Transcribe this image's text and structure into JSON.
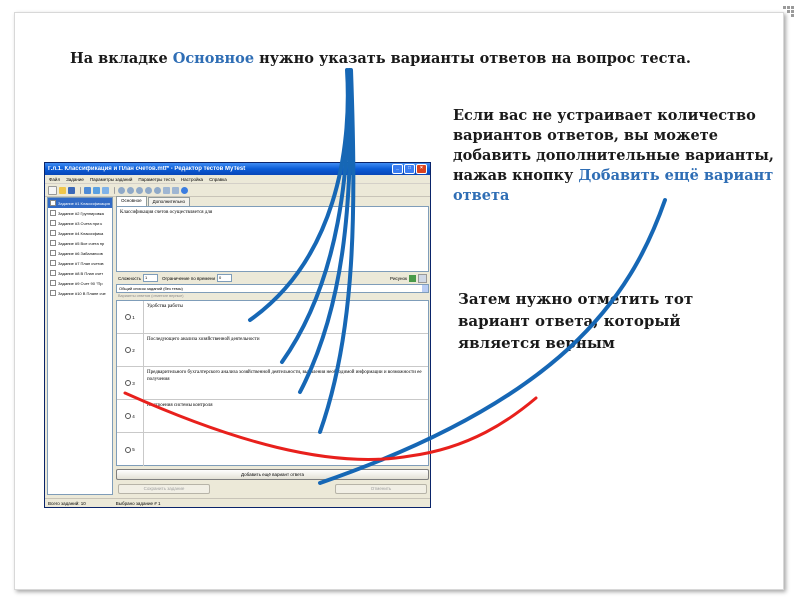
{
  "captions": {
    "main": {
      "before": "На вкладке ",
      "highlight": "Основное",
      "after": " нужно указать варианты ответов на вопрос теста."
    },
    "add": {
      "before": "Если вас не устраивает количество вариантов ответов, вы можете добавить дополнительные варианты, нажав кнопку ",
      "highlight": "Добавить ещё вариант ответа"
    },
    "mark": "Затем нужно отметить тот вариант ответа, который является верным"
  },
  "window": {
    "title": "Г.л.1. Классификация и План счетов.mtf* - Редактор тестов MyTest",
    "controls": [
      "_",
      "□",
      "×"
    ],
    "menu": [
      "Файл",
      "Задание",
      "Параметры заданий",
      "Параметры теста",
      "Настройка",
      "Справка"
    ],
    "toolbar_icons": [
      "new-file-icon",
      "open-folder-icon",
      "save-icon",
      "filter-icon",
      "filter-edit-icon",
      "shuffle-icon",
      "settings-icon",
      "help-icon"
    ],
    "tasks": [
      "Задание #1 Классификация",
      "Задание #2 Группировка",
      "Задание #3 Счета при к",
      "Задание #4 Классифика",
      "Задание #5 Все счета пр",
      "Задание #6 Забалансов",
      "Задание #7 План счетов",
      "Задание #8 В План счет",
      "Задание #9 Счет 90 \"Пр",
      "Задание #10 В Плане сче"
    ],
    "tabs": [
      "Основное",
      "Дополнительно"
    ],
    "question": "Классификация счетов осуществляется для",
    "params": {
      "difficulty_label": "Сложность",
      "difficulty_value": "1",
      "time_limit_label": "Ограничение по времени",
      "time_limit_value": "0",
      "picture_label": "Рисунок"
    },
    "answers_list_value": "Общий список заданий (без темы)",
    "answers_subhead": "Варианты ответов (отметьте верные)",
    "answers": [
      {
        "num": "1",
        "text": "Удобства работы"
      },
      {
        "num": "2",
        "text": "Последующего анализа хозяйственной деятельности"
      },
      {
        "num": "3",
        "text": "Предварительного бухгалтерского анализа хозяйственной деятельности, выявления необходимой информации и возможности ее получения"
      },
      {
        "num": "4",
        "text": "Построения системы контроля"
      },
      {
        "num": "5",
        "text": ""
      }
    ],
    "add_button": "Добавить ещё вариант ответа",
    "save_button": "Сохранить задание",
    "reset_button": "Отменить",
    "status": {
      "total": "Всего заданий: 10",
      "selected": "Выбрано задание # 1"
    }
  },
  "colors": {
    "highlight": "#2f6eb5",
    "pointer_lines": "#1667b5",
    "correct_mark": "#e8201c"
  }
}
